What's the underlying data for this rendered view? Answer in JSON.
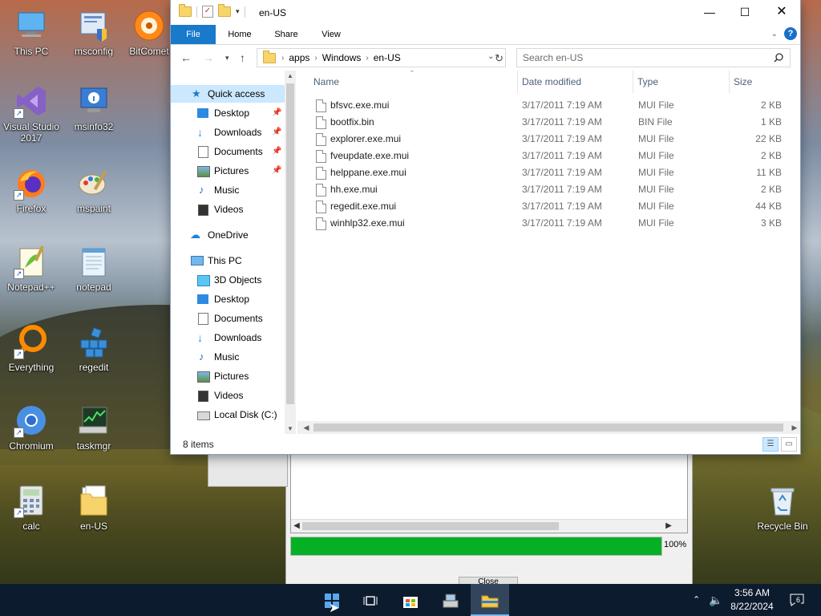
{
  "desktop": {
    "icons": [
      {
        "name": "This PC"
      },
      {
        "name": "msconfig"
      },
      {
        "name": "BitComet"
      },
      {
        "name": "Visual Studio 2017"
      },
      {
        "name": "msinfo32"
      },
      {
        "name": "Firefox"
      },
      {
        "name": "mspaint"
      },
      {
        "name": "Notepad++"
      },
      {
        "name": "notepad"
      },
      {
        "name": "Everything"
      },
      {
        "name": "regedit"
      },
      {
        "name": "Chromium"
      },
      {
        "name": "taskmgr"
      },
      {
        "name": "calc"
      },
      {
        "name": "en-US"
      },
      {
        "name": "Recycle Bin"
      }
    ]
  },
  "installer": {
    "progress": 100,
    "progress_label": "100%",
    "close_label": "Close"
  },
  "explorer": {
    "title": "en-US",
    "ribbon_tabs": [
      "File",
      "Home",
      "Share",
      "View"
    ],
    "help_label": "?",
    "breadcrumb": [
      "apps",
      "Windows",
      "en-US"
    ],
    "search_placeholder": "Search en-US",
    "nav": {
      "quick_access": "Quick access",
      "quick_items": [
        "Desktop",
        "Downloads",
        "Documents",
        "Pictures",
        "Music",
        "Videos"
      ],
      "onedrive": "OneDrive",
      "this_pc": "This PC",
      "pc_items": [
        "3D Objects",
        "Desktop",
        "Documents",
        "Downloads",
        "Music",
        "Pictures",
        "Videos",
        "Local Disk (C:)"
      ]
    },
    "columns": {
      "name": "Name",
      "date": "Date modified",
      "type": "Type",
      "size": "Size"
    },
    "files": [
      {
        "name": "bfsvc.exe.mui",
        "date": "3/17/2011 7:19 AM",
        "type": "MUI File",
        "size": "2 KB"
      },
      {
        "name": "bootfix.bin",
        "date": "3/17/2011 7:19 AM",
        "type": "BIN File",
        "size": "1 KB"
      },
      {
        "name": "explorer.exe.mui",
        "date": "3/17/2011 7:19 AM",
        "type": "MUI File",
        "size": "22 KB"
      },
      {
        "name": "fveupdate.exe.mui",
        "date": "3/17/2011 7:19 AM",
        "type": "MUI File",
        "size": "2 KB"
      },
      {
        "name": "helppane.exe.mui",
        "date": "3/17/2011 7:19 AM",
        "type": "MUI File",
        "size": "11 KB"
      },
      {
        "name": "hh.exe.mui",
        "date": "3/17/2011 7:19 AM",
        "type": "MUI File",
        "size": "2 KB"
      },
      {
        "name": "regedit.exe.mui",
        "date": "3/17/2011 7:19 AM",
        "type": "MUI File",
        "size": "44 KB"
      },
      {
        "name": "winhlp32.exe.mui",
        "date": "3/17/2011 7:19 AM",
        "type": "MUI File",
        "size": "3 KB"
      }
    ],
    "status": "8 items"
  },
  "taskbar": {
    "time": "3:56 AM",
    "date": "8/22/2024",
    "notifications": "6"
  },
  "colors": {
    "accent": "#1979ca",
    "selection": "#cce8ff",
    "progress": "#06b025",
    "taskbar": "#0d1b2e"
  }
}
